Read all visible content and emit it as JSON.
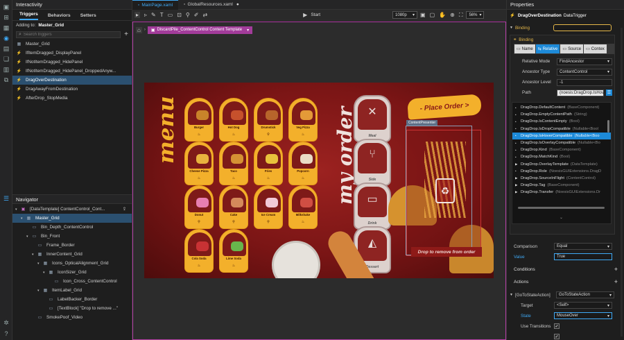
{
  "activity_icons": [
    "screen-icon",
    "add-window-icon",
    "grid-icon",
    "interactivity-icon",
    "film-icon",
    "assets-icon",
    "layers-icon",
    "copy-icon"
  ],
  "left": {
    "title": "Interactivity",
    "tabs": [
      "Triggers",
      "Behaviors",
      "Setters"
    ],
    "adding_to_label": "Adding to:",
    "adding_to_value": "Master_Grid",
    "search_placeholder": "Search triggers",
    "triggers": [
      "Master_Grid",
      "IfItemDragged_DisplayPanel",
      "IfNotItemDragged_HidePanel",
      "IfNotItemDragged_HidePanel_DroppedAnyw...",
      "DragOverDestination",
      "DragAwayFromDestination",
      "AfterDrop_StopMedia"
    ],
    "selected_trigger": 4,
    "navigator_title": "Navigator",
    "nav": [
      {
        "label": "[DataTemplate] ContentControl_Cont...",
        "indent": 0,
        "tri": "▾"
      },
      {
        "label": "Master_Grid",
        "indent": 1,
        "tri": "▾",
        "sel": true
      },
      {
        "label": "Bin_Depth_ContentControl",
        "indent": 2,
        "tri": ""
      },
      {
        "label": "Bin_Front",
        "indent": 2,
        "tri": "▾"
      },
      {
        "label": "Frame_Border",
        "indent": 3,
        "tri": ""
      },
      {
        "label": "InnerContent_Grid",
        "indent": 3,
        "tri": "▾"
      },
      {
        "label": "Icons_OpticalAlignment_Grid",
        "indent": 4,
        "tri": "▾"
      },
      {
        "label": "IconSizer_Grid",
        "indent": 5,
        "tri": "▾"
      },
      {
        "label": "Icon_Cross_ContentControl",
        "indent": 6,
        "tri": ""
      },
      {
        "label": "ItemLabel_Grid",
        "indent": 4,
        "tri": "▾"
      },
      {
        "label": "LabelBacker_Border",
        "indent": 5,
        "tri": ""
      },
      {
        "label": "[TextBlock] \"Drop to remove ...\"",
        "indent": 5,
        "tri": ""
      },
      {
        "label": "SmokePoof_Video",
        "indent": 3,
        "tri": ""
      }
    ]
  },
  "center": {
    "doc_tabs": [
      "MainPage.xaml",
      "GlobalResources.xaml"
    ],
    "start_label": "Start",
    "resolution": "1080p",
    "zoom": "56%",
    "breadcrumb": "DiscardPile_ContentControl Content Template",
    "menu_title": "menu",
    "order_title": "my order",
    "place_order": "- Place Order >",
    "content_presenter": "ContentPresenter",
    "drop_text": "Drop to remove from order",
    "tiles": [
      {
        "label": "Burger",
        "sym": "♨",
        "col": "#c9832a"
      },
      {
        "label": "Hot Dog",
        "sym": "♨",
        "col": "#c6512c"
      },
      {
        "label": "Drumstick",
        "sym": "⚲",
        "col": "#b7652b"
      },
      {
        "label": "Veg Pizza",
        "sym": "♨",
        "col": "#e49a38"
      },
      {
        "label": "Cheese Pizza",
        "sym": "♨",
        "col": "#e8b33e"
      },
      {
        "label": "Taco",
        "sym": "♨",
        "col": "#d59234"
      },
      {
        "label": "Fries",
        "sym": "♨",
        "col": "#e8c23c"
      },
      {
        "label": "Popcorn",
        "sym": "♨",
        "col": "#e9dcc4"
      },
      {
        "label": "Donut",
        "sym": "⚲",
        "col": "#e77fb0"
      },
      {
        "label": "Cake",
        "sym": "⚲",
        "col": "#d58a5b"
      },
      {
        "label": "Ice Cream",
        "sym": "⚲",
        "col": "#f1c9d6"
      },
      {
        "label": "Milkshake",
        "sym": "♨",
        "col": "#d04e43"
      },
      {
        "label": "Cola Soda",
        "sym": "♨",
        "col": "#c83234"
      },
      {
        "label": "Lime Soda",
        "sym": "♨",
        "col": "#68b54c"
      }
    ],
    "order_tiles": [
      {
        "label": "Meal",
        "glyph": "✕"
      },
      {
        "label": "Side",
        "glyph": "⑂"
      },
      {
        "label": "Drink",
        "glyph": "▭"
      },
      {
        "label": "Dessert",
        "glyph": "◭"
      }
    ]
  },
  "right": {
    "title": "Properties",
    "element_name": "DragOverDestination",
    "element_type": "DataTrigger",
    "binding_section": "Binding",
    "binding_sub": "Binding",
    "binding_tabs": [
      "Name",
      "Relative",
      "Source",
      "Contex"
    ],
    "fields": [
      {
        "label": "Relative Mode",
        "value": "FindAncestor",
        "dd": true
      },
      {
        "label": "Ancestor Type",
        "value": "ContentControl",
        "dd": true
      },
      {
        "label": "Ancestor Level",
        "value": "-1",
        "dd": false
      }
    ],
    "path_label": "Path",
    "path_value": "(noesis:DragDrop.IsHove",
    "props": [
      {
        "n": "DragDrop.DefaultContent",
        "t": "(BaseComponent)"
      },
      {
        "n": "DragDrop.EmptyContentPath",
        "t": "(String)"
      },
      {
        "n": "DragDrop.IsContentEmpty",
        "t": "(Bool)"
      },
      {
        "n": "DragDrop.IsDropCompatible",
        "t": "(Nullable<Bool"
      },
      {
        "n": "DragDrop.IsHoverCompatible",
        "t": "(Nullable<Boo",
        "sel": true
      },
      {
        "n": "DragDrop.IsOverlayCompatible",
        "t": "(Nullable<Bo"
      },
      {
        "n": "DragDrop.Kind",
        "t": "(BaseComponent)"
      },
      {
        "n": "DragDrop.MatchKind",
        "t": "(Bool)"
      },
      {
        "n": "DragDrop.OverlayTemplate",
        "t": "(DataTemplate)"
      },
      {
        "n": "DragDrop.Role",
        "t": "(NoesisGUIExtensions.DragD"
      },
      {
        "n": "DragDrop.SourceInFlight",
        "t": "(ContentControl)"
      },
      {
        "n": "DragDrop.Tag",
        "t": "(BaseComponent)"
      },
      {
        "n": "DragDrop.Transfer",
        "t": "(NoesisGUIExtensions.Dr"
      }
    ],
    "comparison_label": "Comparison",
    "comparison_value": "Equal",
    "value_label": "Value",
    "value_value": "True",
    "conditions": "Conditions",
    "actions": "Actions",
    "action_name": "[GoToStateAction]",
    "action_value": "GoToStateAction",
    "target_label": "Target",
    "target_value": "<Self>",
    "state_label": "State",
    "state_value": "MouseOver",
    "use_transitions": "Use Transitions"
  }
}
